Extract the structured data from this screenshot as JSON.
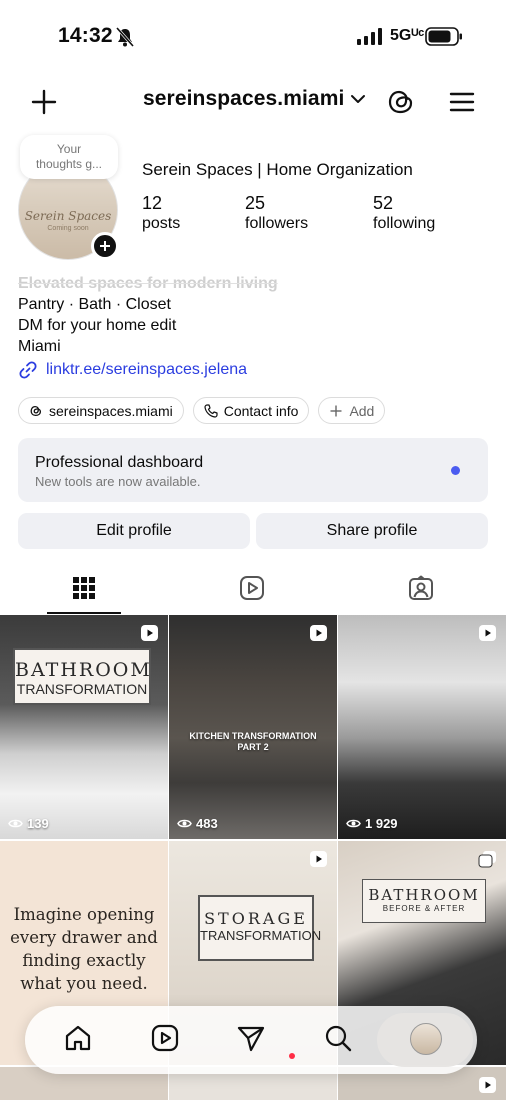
{
  "status_bar": {
    "time": "14:32",
    "network": "5Gᵁᶜ"
  },
  "header": {
    "username": "sereinspaces.miami"
  },
  "profile": {
    "note_lines": [
      "Your",
      "thoughts g..."
    ],
    "avatar_brand": "Serein Spaces",
    "avatar_sub": "Coming soon",
    "display_name": "Serein Spaces | Home Organization",
    "stats": [
      {
        "value": "12",
        "label": "posts"
      },
      {
        "value": "25",
        "label": "followers"
      },
      {
        "value": "52",
        "label": "following"
      }
    ],
    "bio_lines": [
      "Elevated spaces for modern living",
      "Pantry · Bath · Closet",
      "DM for your home edit",
      "Miami"
    ],
    "link": "linktr.ee/sereinspaces.jelena"
  },
  "chips": {
    "threads": "sereinspaces.miami",
    "contact": "Contact info",
    "add": "Add"
  },
  "dashboard": {
    "title": "Professional dashboard",
    "subtitle": "New tools are now available."
  },
  "buttons": {
    "edit": "Edit profile",
    "share": "Share profile"
  },
  "grid": {
    "tile1": {
      "line1": "BATHROOM",
      "line2": "TRANSFORMATION",
      "views": "139"
    },
    "tile2": {
      "line1": "KITCHEN TRANSFORMATION",
      "line2": "PART 2",
      "views": "483"
    },
    "tile3": {
      "views": "1 929"
    },
    "tile4": {
      "quote_lines": [
        "Imagine opening",
        "every drawer and",
        "finding exactly",
        "what you need."
      ]
    },
    "tile5": {
      "line1": "STORAGE",
      "line2": "TRANSFORMATION"
    },
    "tile6": {
      "line1": "BATHROOM",
      "line2": "BEFORE & AFTER"
    }
  },
  "colors": {
    "link": "#2b3de0",
    "notification_dot": "#4b5cf0",
    "button_bg": "#eff0f4",
    "nav_dot": "#ff2d46"
  }
}
